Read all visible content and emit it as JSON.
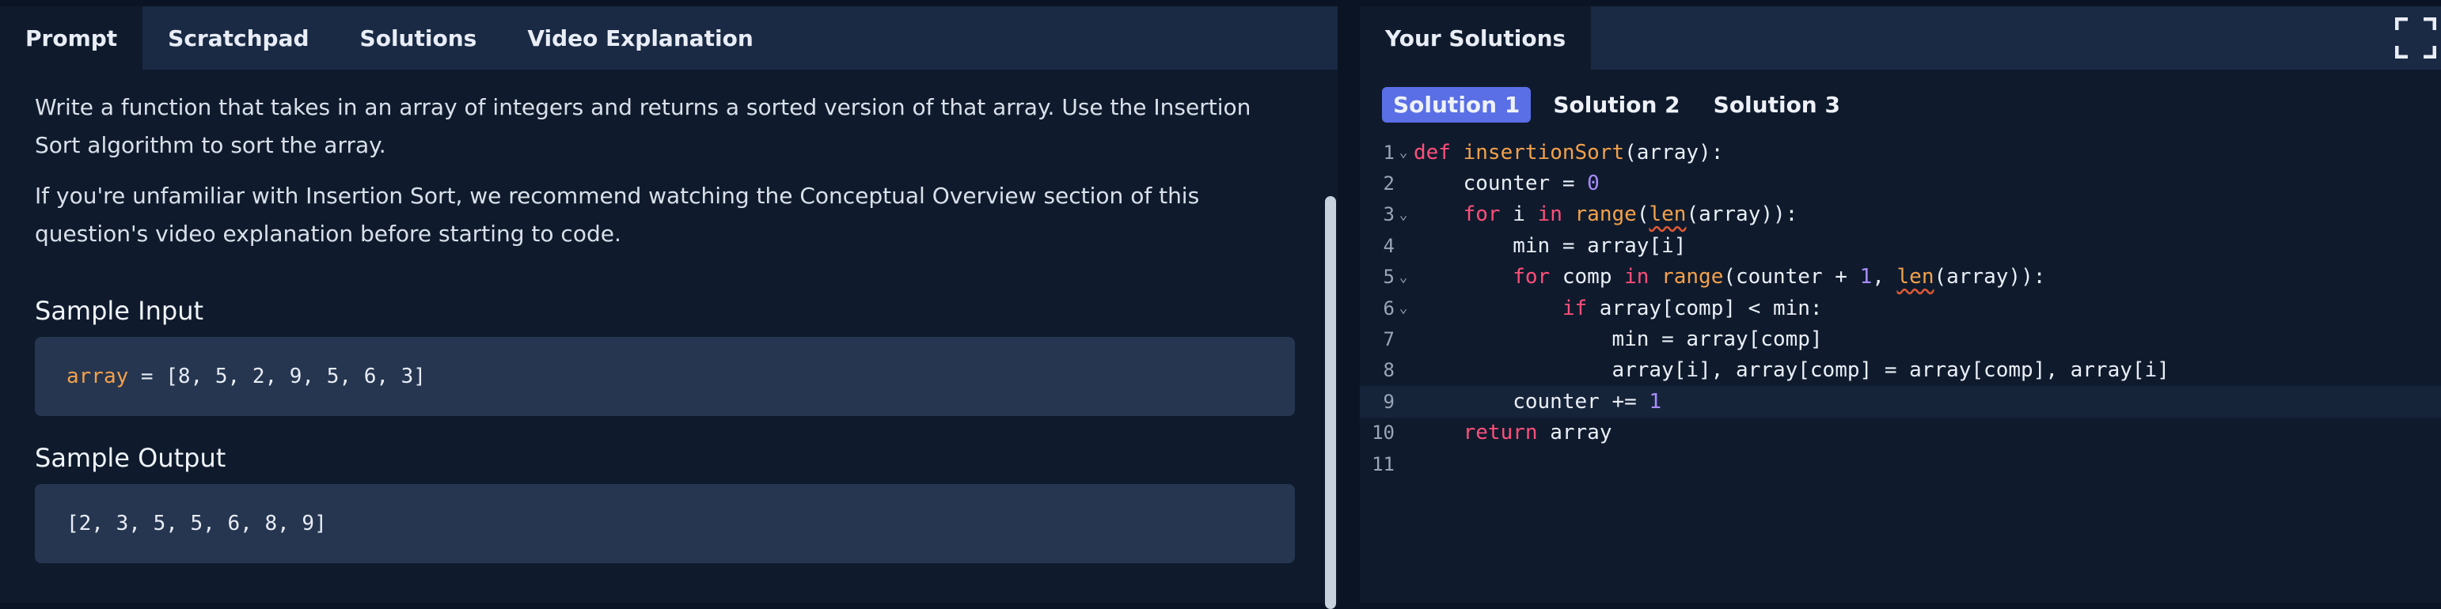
{
  "left_tabs": [
    "Prompt",
    "Scratchpad",
    "Solutions",
    "Video Explanation"
  ],
  "prompt": {
    "paragraph1": "Write a function that takes in an array of integers and returns a sorted version of that array. Use the Insertion Sort algorithm to sort the array.",
    "paragraph2": "If you're unfamiliar with Insertion Sort, we recommend watching the Conceptual Overview section of this question's video explanation before starting to code.",
    "sample_input_title": "Sample Input",
    "sample_input_var": "array",
    "sample_input_rest": " = [8, 5, 2, 9, 5, 6, 3]",
    "sample_output_title": "Sample Output",
    "sample_output": "[2, 3, 5, 5, 6, 8, 9]"
  },
  "right": {
    "tab": "Your Solutions",
    "solutions": [
      "Solution 1",
      "Solution 2",
      "Solution 3"
    ],
    "active_solution": "Solution 1"
  },
  "editor": {
    "line_numbers": [
      "1",
      "2",
      "3",
      "4",
      "5",
      "6",
      "7",
      "8",
      "9",
      "10",
      "11"
    ],
    "highlighted_line": 9,
    "colors": {
      "keyword": "#ff4f7a",
      "function": "#f4a14a",
      "number": "#a98cff"
    }
  }
}
